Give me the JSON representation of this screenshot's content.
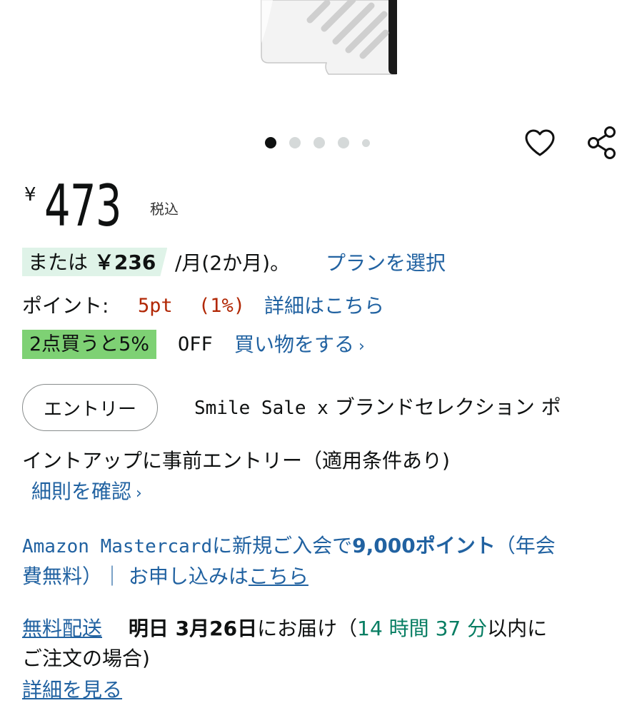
{
  "carousel": {
    "count": 5,
    "active_index": 0
  },
  "price": {
    "currency": "¥",
    "amount": "473",
    "tax_label": "税込"
  },
  "installment": {
    "prefix": "または",
    "amount": "￥236",
    "suffix": "/月(2か月)。",
    "link": "プランを選択"
  },
  "points": {
    "label": "ポイント:",
    "value": "5pt",
    "percent": "(1%)",
    "link": "詳細はこちら"
  },
  "bulk_discount": {
    "badge": "2点買うと5%",
    "off": "OFF",
    "link": "買い物をする",
    "chevron": "›"
  },
  "entry": {
    "button": "エントリー",
    "line1_mono": "Smile Sale x",
    "line1_rest": "ブランドセレクション ポ",
    "line2": "イントアップに事前エントリー（適用条件あり)",
    "rules_link": "細則を確認",
    "chevron": "›"
  },
  "card_promo": {
    "mono": "Amazon Mastercard",
    "text1": "に新規ご入会で",
    "points": "9,000ポイント",
    "text2": "（年会",
    "text3": "費無料）｜ お申し込みは",
    "link": "こちら"
  },
  "delivery": {
    "free_link": "無料配送",
    "date_label": "明日 3月26日",
    "text1": "にお届け（",
    "hours": "14 時間",
    "minutes": "37 分",
    "text2": "以内に",
    "text3": "ご注文の場合)",
    "details_link": "詳細を見る"
  },
  "colors": {
    "link": "#2162a1",
    "price_points": "#b12704",
    "countdown": "#067d62",
    "plan_badge_bg": "#dff3e8",
    "bulk_badge_bg": "#7ed174"
  },
  "icons": {
    "wishlist": "heart-icon",
    "share": "share-icon"
  }
}
